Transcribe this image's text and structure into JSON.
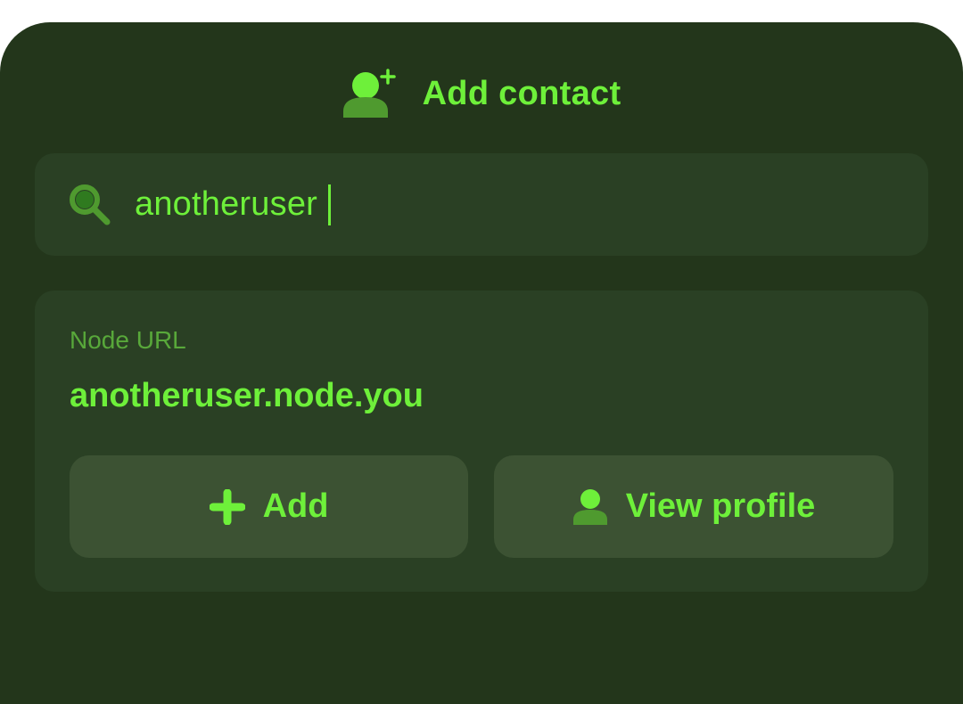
{
  "header": {
    "title": "Add contact",
    "icon": "add-person-icon"
  },
  "search": {
    "icon": "search-icon",
    "value": "anotheruser"
  },
  "result": {
    "label": "Node URL",
    "value": "anotheruser.node.you",
    "actions": [
      {
        "label": "Add",
        "icon": "plus-icon"
      },
      {
        "label": "View profile",
        "icon": "person-icon"
      }
    ]
  },
  "colors": {
    "background": "#23361b",
    "card": "#2a4024",
    "button": "#3c5233",
    "accent": "#6ef03a",
    "muted_accent": "#58a83a"
  }
}
